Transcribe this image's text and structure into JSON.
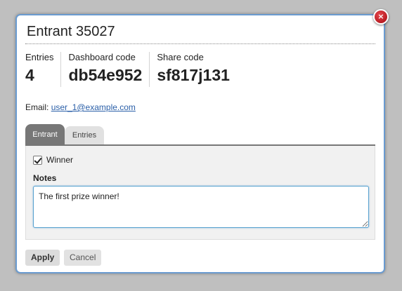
{
  "dialog": {
    "title": "Entrant 35027",
    "close_icon": "×"
  },
  "stats": [
    {
      "label": "Entries",
      "value": "4"
    },
    {
      "label": "Dashboard code",
      "value": "db54e952"
    },
    {
      "label": "Share code",
      "value": "sf817j131"
    }
  ],
  "email": {
    "label": "Email:",
    "value": "user_1@example.com"
  },
  "tabs": [
    {
      "label": "Entrant",
      "active": true
    },
    {
      "label": "Entries",
      "active": false
    }
  ],
  "form": {
    "winner_label": "Winner",
    "winner_checked": true,
    "notes_label": "Notes",
    "notes_value": "The first prize winner!"
  },
  "buttons": {
    "apply": "Apply",
    "cancel": "Cancel"
  },
  "colors": {
    "accent": "#6a9bd0",
    "close": "#c21f26",
    "link": "#2a5fa8"
  }
}
